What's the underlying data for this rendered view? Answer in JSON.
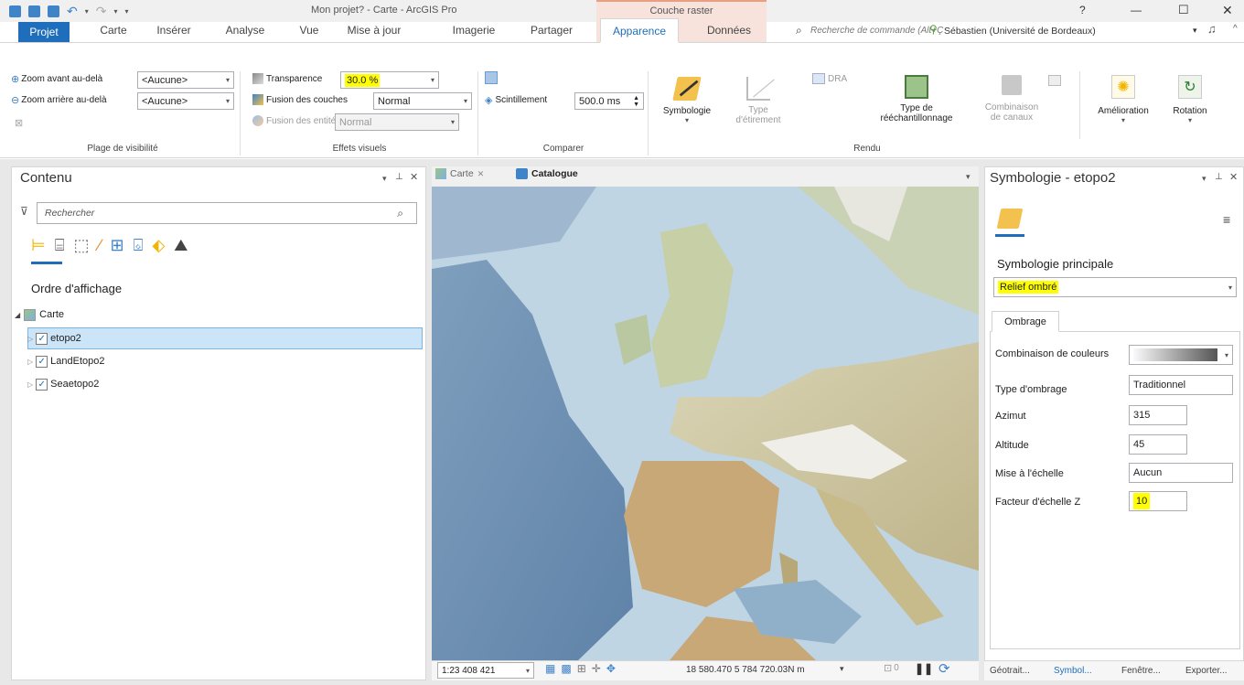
{
  "window": {
    "title": "Mon projet? - Carte - ArcGIS Pro",
    "context_tab": "Couche raster",
    "help": "?",
    "minimize": "—",
    "maximize": "☐",
    "close": "✕"
  },
  "ribbon_tabs": [
    "Projet",
    "Carte",
    "Insérer",
    "Analyse",
    "Vue",
    "Mise à jour",
    "Imagerie",
    "Partager",
    "Apparence",
    "Données"
  ],
  "search": {
    "placeholder": "Recherche de commande (Alt+Ç"
  },
  "user": {
    "name": "Sébastien (Université de Bordeaux)",
    "caret": "▾"
  },
  "ribbon": {
    "visibility": {
      "zoom_in_label": "Zoom avant au-delà",
      "zoom_in_value": "<Aucune>",
      "zoom_out_label": "Zoom arrière au-delà",
      "zoom_out_value": "<Aucune>",
      "group_label": "Plage de visibilité"
    },
    "effects": {
      "transparency_label": "Transparence",
      "transparency_value": "30.0 %",
      "layer_blend_label": "Fusion des couches",
      "layer_blend_value": "Normal",
      "feature_blend_label": "Fusion des entités",
      "feature_blend_value": "Normal",
      "group_label": "Effets visuels"
    },
    "compare": {
      "flicker_label": "Scintillement",
      "flicker_value": "500.0 ms",
      "group_label": "Comparer"
    },
    "render": {
      "symbology": "Symbologie",
      "stretch_type_1": "Type",
      "stretch_type_2": "d'étirement",
      "dra": "DRA",
      "resampling_1": "Type de",
      "resampling_2": "rééchantillonnage",
      "band_comb_1": "Combinaison",
      "band_comb_2": "de canaux",
      "enhancement": "Amélioration",
      "rotation": "Rotation",
      "group_label": "Rendu"
    }
  },
  "contents": {
    "title": "Contenu",
    "filter_placeholder": "Rechercher",
    "section": "Ordre d'affichage",
    "map": "Carte",
    "layers": [
      {
        "name": "etopo2",
        "checked": true,
        "selected": true
      },
      {
        "name": "LandEtopo2",
        "checked": true,
        "selected": false
      },
      {
        "name": "Seaetopo2",
        "checked": true,
        "selected": false
      }
    ]
  },
  "view_tabs": [
    {
      "label": "Carte",
      "active": false
    },
    {
      "label": "Catalogue",
      "active": true
    }
  ],
  "statusbar": {
    "scale": "1:23 408 421",
    "coords": "18 580.470 5 784 720.03N m",
    "selected_count": "0"
  },
  "symbology": {
    "title": "Symbologie - etopo2",
    "primary_label": "Symbologie principale",
    "primary_value": "Relief ombré",
    "tab": "Ombrage",
    "rows": [
      {
        "label": "Combinaison de couleurs",
        "value": ""
      },
      {
        "label": "Type d'ombrage",
        "value": "Traditionnel"
      },
      {
        "label": "Azimut",
        "value": "315"
      },
      {
        "label": "Altitude",
        "value": "45"
      },
      {
        "label": "Mise à l'échelle",
        "value": "Aucun"
      },
      {
        "label": "Facteur d'échelle Z",
        "value": "10"
      }
    ]
  },
  "bottom_tabs": [
    "Géotrait...",
    "Symbol...",
    "Fenêtre...",
    "Exporter..."
  ],
  "colors": {
    "accent": "#1f6ebc",
    "highlight": "#ffff00",
    "context_tab": "#f7e3dc"
  }
}
